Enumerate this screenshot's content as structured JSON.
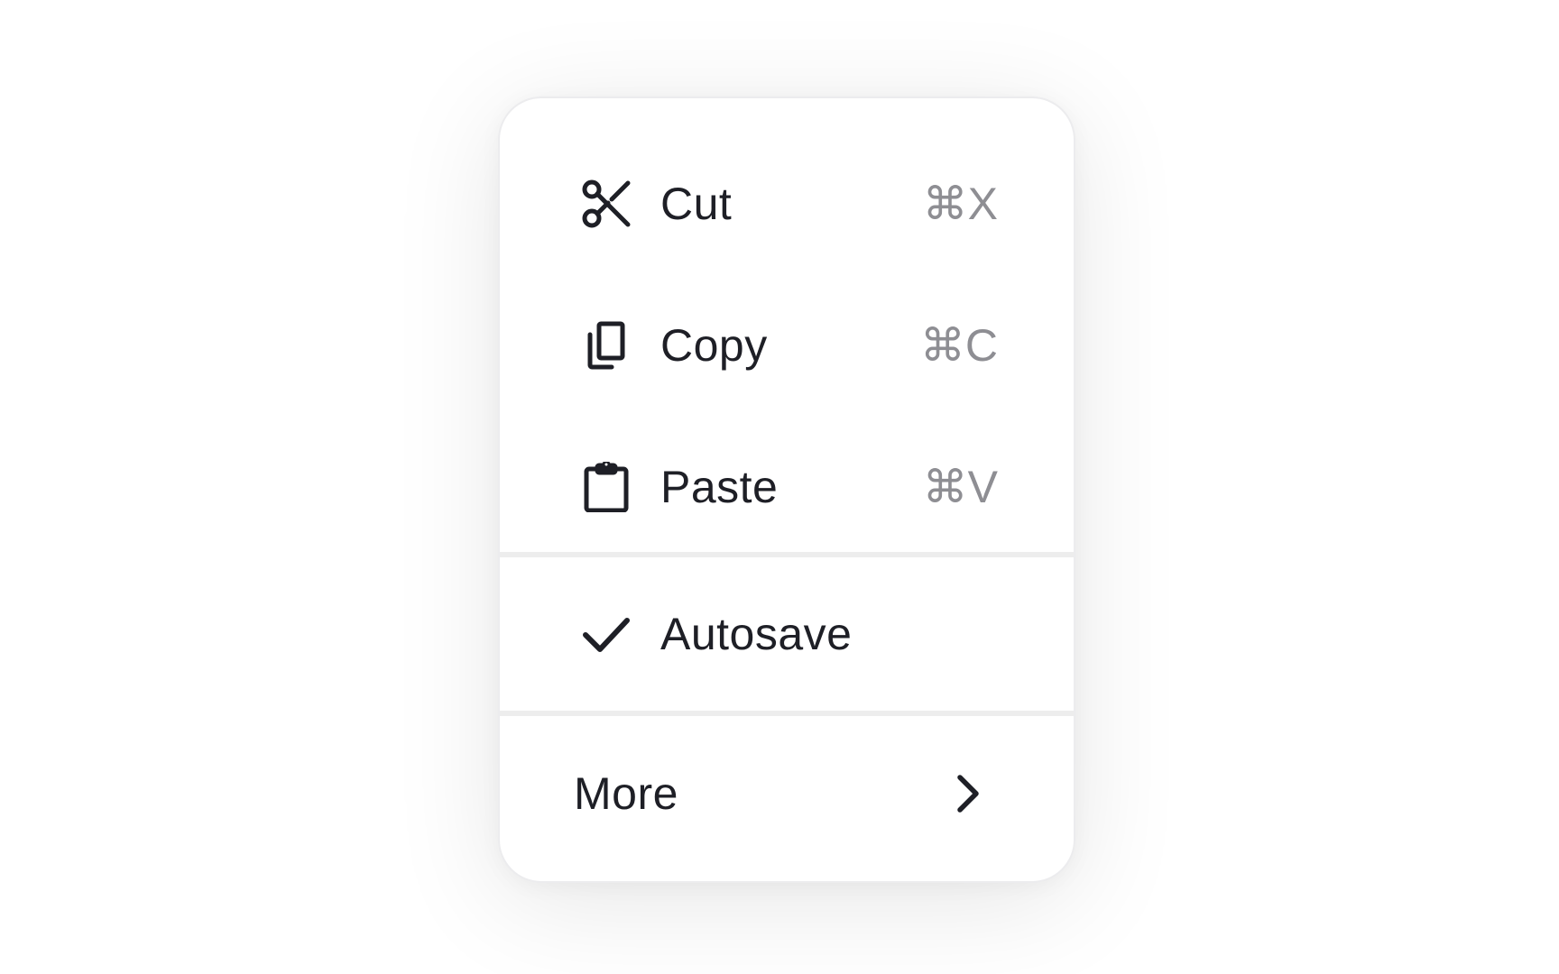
{
  "menu": {
    "edit_items": [
      {
        "label": "Cut",
        "shortcut": "⌘X",
        "icon": "scissors-icon"
      },
      {
        "label": "Copy",
        "shortcut": "⌘C",
        "icon": "copy-icon"
      },
      {
        "label": "Paste",
        "shortcut": "⌘V",
        "icon": "clipboard-icon"
      }
    ],
    "toggle_item": {
      "label": "Autosave",
      "checked": true,
      "icon": "checkmark-icon"
    },
    "submenu_item": {
      "label": "More",
      "icon": "chevron-right-icon"
    }
  },
  "colors": {
    "text": "#1e1f26",
    "shortcut": "#8e8e93",
    "divider": "#ededed",
    "background": "#ffffff"
  }
}
